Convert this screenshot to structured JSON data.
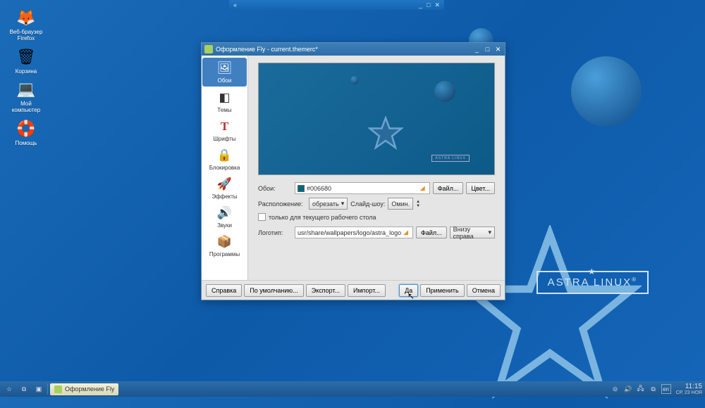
{
  "desktop": {
    "icons": [
      {
        "label": "Веб-браузер\nFirefox",
        "emoji": "🦊",
        "name": "firefox"
      },
      {
        "label": "Корзина",
        "emoji": "🗑",
        "name": "trash"
      },
      {
        "label": "Мой\nкомпьютер",
        "emoji": "💻",
        "name": "my-computer"
      },
      {
        "label": "Помощь",
        "emoji": "🛟",
        "name": "help"
      }
    ],
    "astra_label": "ASTRA LINUX"
  },
  "dialog": {
    "title": "Оформление Fly - current.themerc*",
    "sidebar": [
      {
        "label": "Обои",
        "icon": "🖼",
        "active": true,
        "name": "wallpaper"
      },
      {
        "label": "Темы",
        "icon": "◧",
        "name": "themes"
      },
      {
        "label": "Шрифты",
        "icon": "T",
        "name": "fonts",
        "color": "#c03030"
      },
      {
        "label": "Блокировка",
        "icon": "🔒",
        "name": "lock"
      },
      {
        "label": "Эффекты",
        "icon": "🚀",
        "name": "effects"
      },
      {
        "label": "Звуки",
        "icon": "🔊",
        "name": "sounds"
      },
      {
        "label": "Программы",
        "icon": "📦",
        "name": "programs"
      }
    ],
    "form": {
      "wallpaper_label": "Обои:",
      "wallpaper_value": "#006680",
      "file_btn": "Файл...",
      "color_btn": "Цвет...",
      "layout_label": "Расположение:",
      "layout_value": "обрезать",
      "slideshow_label": "Слайд-шоу:",
      "slideshow_value": "Омин.",
      "checkbox_label": "только для текущего рабочего стола",
      "logo_label": "Логотип:",
      "logo_value": "usr/share/wallpapers/logo/astra_logo",
      "logo_pos": "Внизу справа"
    },
    "footer": {
      "help": "Справка",
      "default": "По умолчанию...",
      "export": "Экспорт...",
      "import": "Импорт...",
      "yes": "Да",
      "apply": "Применить",
      "cancel": "Отмена"
    },
    "preview_badge": "ASTRA LINUX"
  },
  "taskbar": {
    "app": "Оформление Fly",
    "lang": "en",
    "time": "11:15",
    "date": "СР, 23 НОЯ"
  }
}
